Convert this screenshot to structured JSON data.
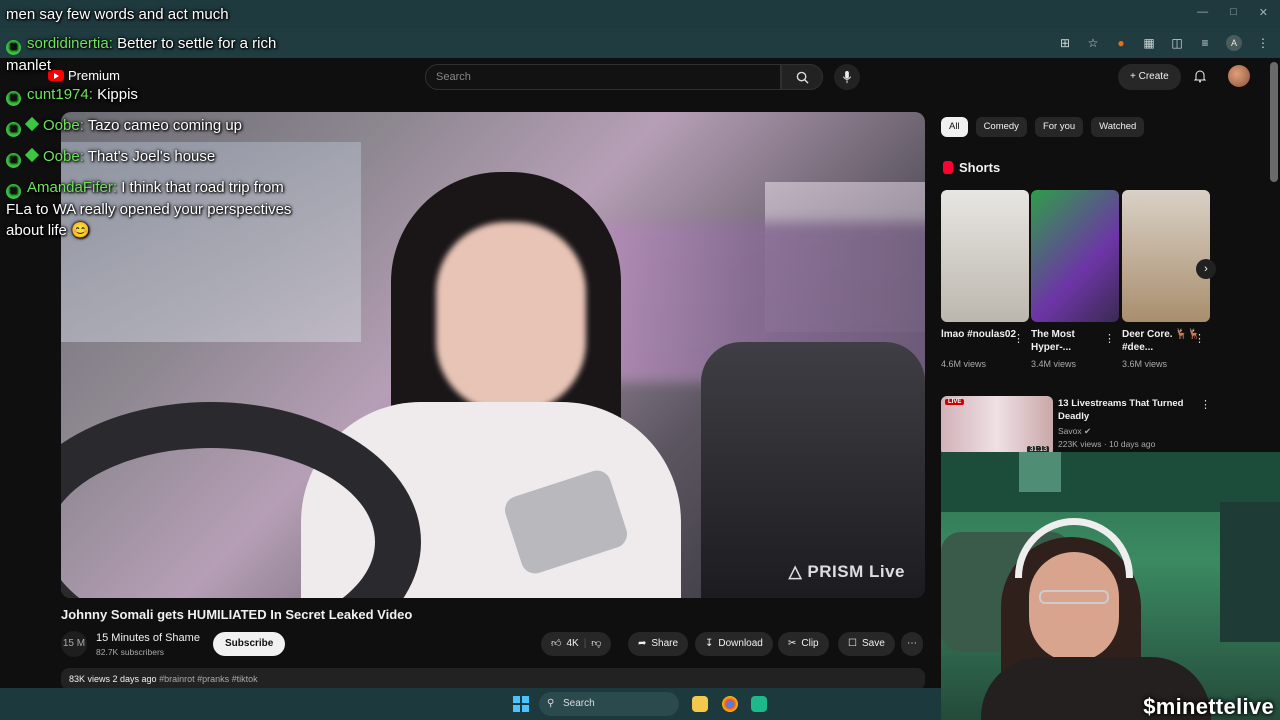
{
  "chat": [
    {
      "text": "men say few words and act much"
    },
    {
      "user": "sordidinertia:",
      "text": "Better to settle for a rich"
    },
    {
      "text": "manlet"
    },
    {
      "user": "cunt1974:",
      "text": "Kippis"
    },
    {
      "user": "Oobe:",
      "text": "Tazo cameo coming up"
    },
    {
      "user": "Oobe:",
      "text": "That's Joel's house"
    },
    {
      "user": "AmandaFifer:",
      "text": "I think that road trip from"
    },
    {
      "text": "FLa to WA really opened your perspectives"
    },
    {
      "text": "about life 😊"
    }
  ],
  "header": {
    "logo_label": "Premium",
    "search_placeholder": "Search",
    "create_label": "Create",
    "profile_initial": "A"
  },
  "video": {
    "watermark": "PRISM Live",
    "title": "Johnny Somali gets HUMILIATED In Secret Leaked Video",
    "channel_avatar": "15 M",
    "channel_name": "15 Minutes of Shame",
    "subscribers": "82.7K subscribers",
    "subscribe_label": "Subscribe",
    "likes": "4K",
    "share_label": "Share",
    "download_label": "Download",
    "clip_label": "Clip",
    "save_label": "Save",
    "views_date": "83K views  2 days ago",
    "tags": "#brainrot #pranks #tiktok"
  },
  "chips": [
    "All",
    "Comedy",
    "For you",
    "Watched"
  ],
  "shorts": {
    "heading": "Shorts",
    "items": [
      {
        "title": "lmao #noulas02",
        "views": "4.6M views"
      },
      {
        "title": "The Most Hyper-...",
        "views": "3.4M views"
      },
      {
        "title": "Deer Core. 🦌🦌 #dee...",
        "views": "3.6M views"
      }
    ]
  },
  "recommendation": {
    "badge": "LIVE",
    "duration": "31:13",
    "title": "13 Livestreams That Turned Deadly",
    "channel": "Savox",
    "meta": "223K views · 10 days ago"
  },
  "webcam": {
    "handle": "$minettelive"
  },
  "taskbar": {
    "search_label": "Search"
  }
}
